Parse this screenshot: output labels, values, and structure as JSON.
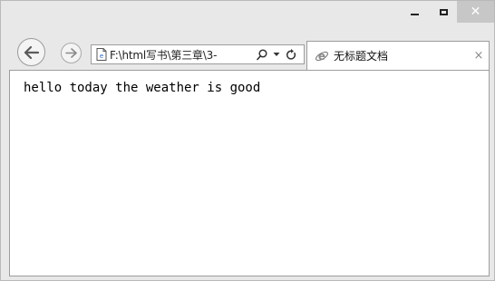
{
  "window": {
    "minimize_icon": "minimize-icon",
    "maximize_icon": "maximize-icon",
    "close_glyph": "✕",
    "close_color": "#c7c7c7"
  },
  "nav": {
    "back_icon": "back-arrow-icon",
    "forward_icon": "forward-arrow-icon",
    "address_value": "F:\\html写书\\第三章\\3-",
    "page_icon": "page-icon",
    "search_icon": "search-icon",
    "dropdown_icon": "chevron-down-icon",
    "refresh_icon": "refresh-icon"
  },
  "tab": {
    "title": "无标题文档",
    "icon": "ie-icon",
    "close_glyph": "×"
  },
  "page": {
    "text": "hello today the weather is good"
  }
}
